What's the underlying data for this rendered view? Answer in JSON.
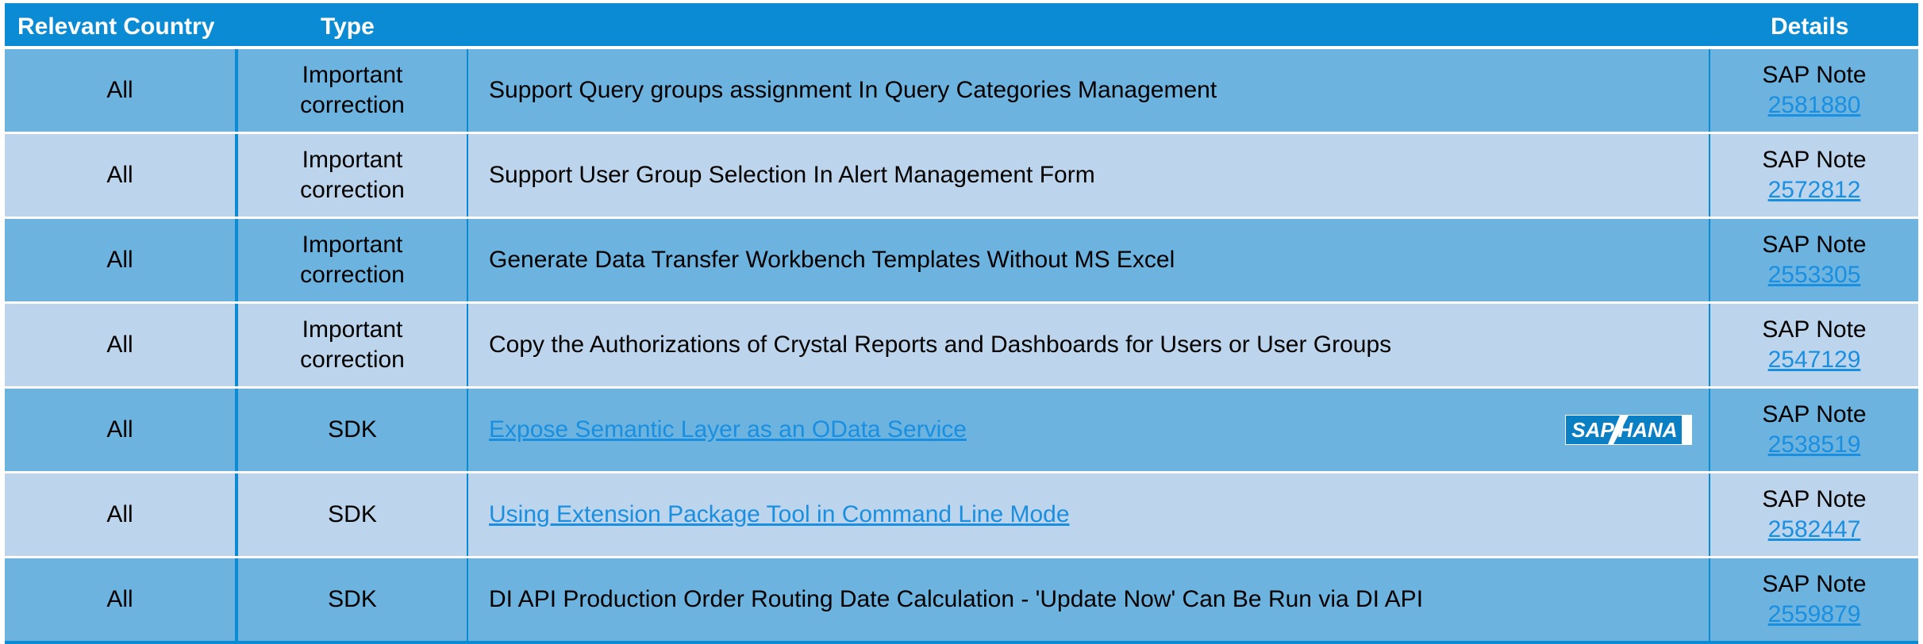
{
  "header": {
    "country": "Relevant Country",
    "type": "Type",
    "details": "Details"
  },
  "rows": [
    {
      "country": "All",
      "type_line1": "Important",
      "type_line2": "correction",
      "description": "Support Query groups assignment In Query Categories Management",
      "description_is_link": false,
      "details_label": "SAP Note",
      "note": "2581880"
    },
    {
      "country": "All",
      "type_line1": "Important",
      "type_line2": "correction",
      "description": "Support User Group Selection In Alert Management Form",
      "description_is_link": false,
      "details_label": "SAP Note",
      "note": "2572812"
    },
    {
      "country": "All",
      "type_line1": "Important",
      "type_line2": "correction",
      "description": "Generate Data Transfer Workbench Templates Without MS Excel",
      "description_is_link": false,
      "details_label": "SAP Note",
      "note": "2553305"
    },
    {
      "country": "All",
      "type_line1": "Important",
      "type_line2": "correction",
      "description": "Copy the Authorizations of Crystal Reports and Dashboards for Users or User Groups",
      "description_is_link": false,
      "details_label": "SAP Note",
      "note": "2547129"
    },
    {
      "country": "All",
      "type_line1": "SDK",
      "type_line2": "",
      "description": "Expose Semantic Layer as an OData Service",
      "description_is_link": true,
      "badge": {
        "left": "SAP",
        "right": "HANA"
      },
      "details_label": "SAP Note",
      "note": "2538519"
    },
    {
      "country": "All",
      "type_line1": "SDK",
      "type_line2": "",
      "description": "Using Extension Package Tool in Command Line Mode",
      "description_is_link": true,
      "details_label": "SAP Note",
      "note": "2582447"
    },
    {
      "country": "All",
      "type_line1": "SDK",
      "type_line2": "",
      "description": "DI API Production Order Routing Date Calculation - 'Update Now' Can Be Run via DI API",
      "description_is_link": false,
      "details_label": "SAP Note",
      "note": "2559879"
    }
  ],
  "colors": {
    "header_bg": "#0a8bd4",
    "row_dark": "#6cb3e0",
    "row_light": "#bdd5ec",
    "link": "#1a8fe0"
  }
}
